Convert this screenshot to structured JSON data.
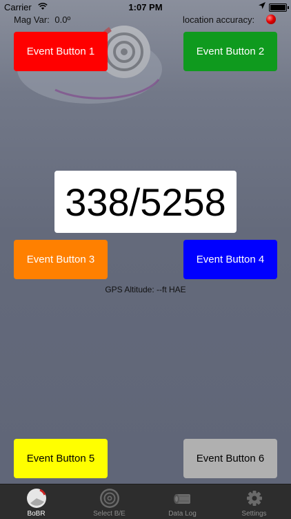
{
  "status_bar": {
    "carrier": "Carrier",
    "time": "1:07 PM"
  },
  "header": {
    "mag_var_label": "Mag Var:",
    "mag_var_value": "0.0º",
    "location_accuracy_label": "location accuracy:"
  },
  "buttons": [
    {
      "label": "Event Button 1",
      "color": "#ff0000"
    },
    {
      "label": "Event Button 2",
      "color": "#0f9a1e"
    },
    {
      "label": "Event Button 3",
      "color": "#ff8000"
    },
    {
      "label": "Event Button 4",
      "color": "#0000ff"
    },
    {
      "label": "Event Button 5",
      "color": "#ffff00"
    },
    {
      "label": "Event Button 6",
      "color": "#b0b0b0"
    }
  ],
  "readout": {
    "value": "338/5258"
  },
  "altitude": {
    "text": "GPS Altitude: --ft HAE"
  },
  "accuracy_indicator_color": "#e00000",
  "tabs": [
    {
      "label": "BoBR",
      "icon": "bobr-ball-icon",
      "active": true
    },
    {
      "label": "Select B/E",
      "icon": "target-icon",
      "active": false
    },
    {
      "label": "Data Log",
      "icon": "log-icon",
      "active": false
    },
    {
      "label": "Settings",
      "icon": "gear-icon",
      "active": false
    }
  ]
}
